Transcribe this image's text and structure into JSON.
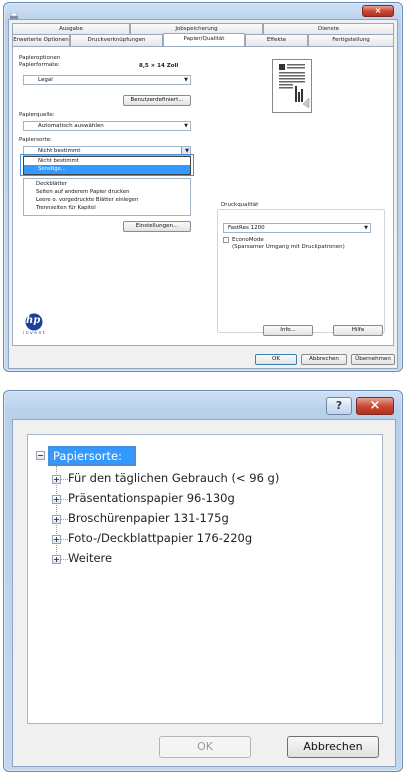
{
  "top_dialog": {
    "tabs_row1": [
      "Ausgabe",
      "Jobspeicherung",
      "Dienste"
    ],
    "tabs_row2": [
      "Erweiterte Optionen",
      "Druckverknüpfungen",
      "Papier/Qualität",
      "Effekte",
      "Fertigstellung"
    ],
    "paper_options_label": "Papieroptionen",
    "paper_formats_label": "Papierformate:",
    "paper_size_value": "8,5 × 14 Zoll",
    "paper_size_combo": "Legal",
    "custom_button": "Benutzerdefiniert...",
    "paper_source_label": "Papierquelle:",
    "paper_source_combo": "Automatisch auswählen",
    "paper_type_label": "Papiersorte:",
    "paper_type_combo": "Nicht bestimmt",
    "dropdown_items": [
      "Nicht bestimmt",
      "Sonstige..."
    ],
    "special_pages_items": [
      "Deckblätter",
      "Seiten auf anderem Papier drucken",
      "Leere o. vorgedruckte Blätter einlegen",
      "Trennseiten für Kapitel"
    ],
    "settings_button": "Einstellungen...",
    "print_quality_label": "Druckqualität",
    "print_quality_combo": "FastRes 1200",
    "econo_mode_label": "EconoMode",
    "econo_mode_sub": "(Sparsamer Umgang mit Druckpatronen)",
    "info_button": "Info...",
    "help_button": "Hilfe",
    "ok_button": "OK",
    "cancel_button": "Abbrechen",
    "apply_button": "Übernehmen",
    "logo_text": "hp",
    "logo_subtext": "invent",
    "close_glyph": "×"
  },
  "bottom_dialog": {
    "help_glyph": "?",
    "close_glyph": "×",
    "tree_root": "Papiersorte:",
    "tree_items": [
      "Für den täglichen Gebrauch (< 96 g)",
      "Präsentationspapier 96-130g",
      "Broschürenpapier 131-175g",
      "Foto-/Deckblattpapier 176-220g",
      "Weitere"
    ],
    "ok_button": "OK",
    "cancel_button": "Abbrechen"
  },
  "colors": {
    "title_bar": "#c3d7ef",
    "selection_blue": "#3399ff",
    "highlight_box": "#4a90d9",
    "close_red": "#c94a36"
  }
}
